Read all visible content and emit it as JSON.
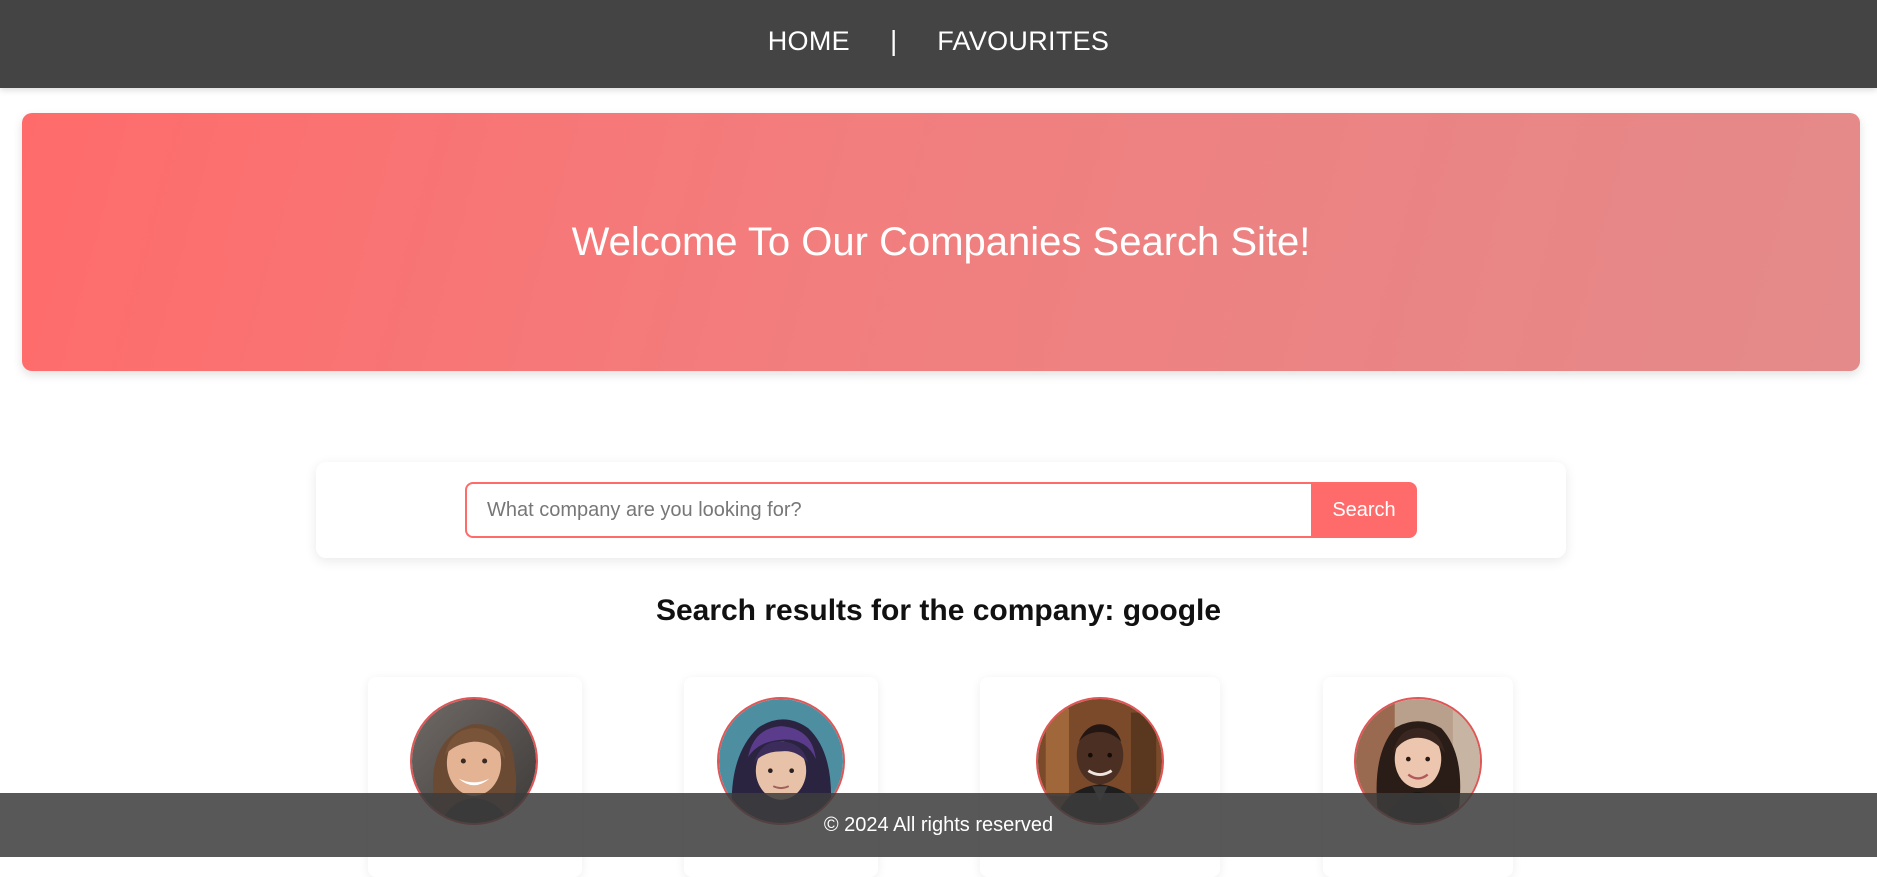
{
  "nav": {
    "home_label": "HOME",
    "separator": "|",
    "favourites_label": "FAVOURITES"
  },
  "hero": {
    "title": "Welcome To Our Companies Search Site!"
  },
  "search": {
    "placeholder": "What company are you looking for?",
    "value": "",
    "button_label": "Search"
  },
  "results": {
    "heading": "Search results for the company: google",
    "people": [
      {
        "avatar_icon": "woman-curly-hair-avatar"
      },
      {
        "avatar_icon": "woman-purple-hair-avatar"
      },
      {
        "avatar_icon": "man-dark-shirt-avatar"
      },
      {
        "avatar_icon": "woman-long-dark-hair-avatar"
      }
    ]
  },
  "footer": {
    "text": "© 2024 All rights reserved"
  },
  "colors": {
    "accent": "#ff6b6b",
    "navbar": "#444444",
    "footer": "#3c3c3c"
  }
}
